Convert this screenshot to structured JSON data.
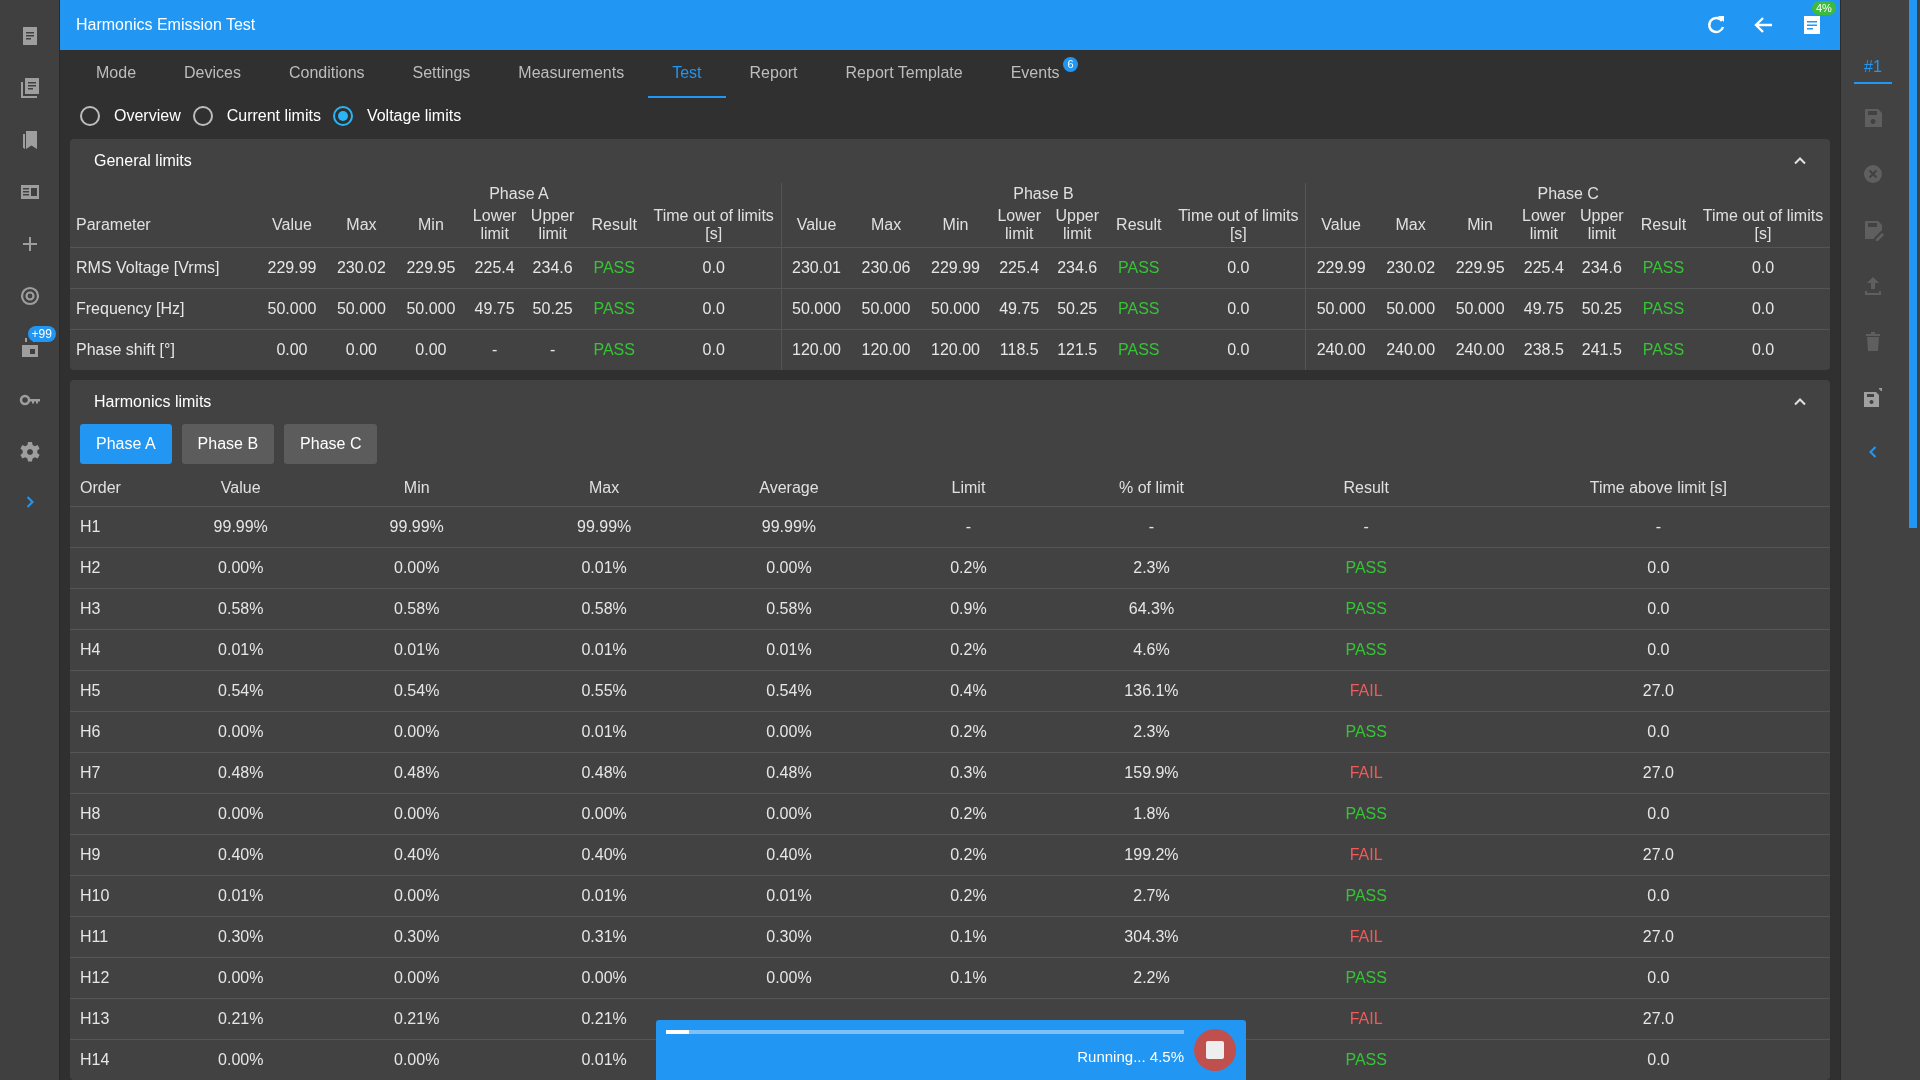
{
  "window": {
    "title": "Harmonics Emission Test",
    "report_badge": "4%"
  },
  "left_sidebar": {
    "calendar_badge": "+99"
  },
  "tabs": [
    {
      "label": "Mode",
      "selected": false
    },
    {
      "label": "Devices",
      "selected": false
    },
    {
      "label": "Conditions",
      "selected": false
    },
    {
      "label": "Settings",
      "selected": false
    },
    {
      "label": "Measurements",
      "selected": false
    },
    {
      "label": "Test",
      "selected": true
    },
    {
      "label": "Report",
      "selected": false
    },
    {
      "label": "Report Template",
      "selected": false
    },
    {
      "label": "Events",
      "selected": false,
      "badge": "6"
    }
  ],
  "view_options": [
    {
      "label": "Overview",
      "selected": false
    },
    {
      "label": "Current limits",
      "selected": false
    },
    {
      "label": "Voltage limits",
      "selected": true
    }
  ],
  "right_sidebar": {
    "tab": {
      "label": "#1",
      "selected": true
    }
  },
  "general_limits": {
    "title": "General limits",
    "expanded": true,
    "parameter_column": "Parameter",
    "phases": [
      {
        "name": "Phase A",
        "columns": [
          "Value",
          "Max",
          "Min",
          "Lower limit",
          "Upper limit",
          "Result",
          "Time out of limits [s]"
        ]
      },
      {
        "name": "Phase B",
        "columns": [
          "Value",
          "Max",
          "Min",
          "Lower limit",
          "Upper limit",
          "Result",
          "Time out of limits [s]"
        ]
      },
      {
        "name": "Phase C",
        "columns": [
          "Value",
          "Max",
          "Min",
          "Lower limit",
          "Upper limit",
          "Result",
          "Time out of limits [s]"
        ]
      }
    ],
    "rows": [
      {
        "parameter": "RMS Voltage [Vrms]",
        "phases": [
          {
            "values": [
              "229.99",
              "230.02",
              "229.95",
              "225.4",
              "234.6"
            ],
            "result": "PASS",
            "color": "#35c435",
            "time": "0.0"
          },
          {
            "values": [
              "230.01",
              "230.06",
              "229.99",
              "225.4",
              "234.6"
            ],
            "result": "PASS",
            "color": "#35c435",
            "time": "0.0"
          },
          {
            "values": [
              "229.99",
              "230.02",
              "229.95",
              "225.4",
              "234.6"
            ],
            "result": "PASS",
            "color": "#35c435",
            "time": "0.0"
          }
        ]
      },
      {
        "parameter": "Frequency [Hz]",
        "phases": [
          {
            "values": [
              "50.000",
              "50.000",
              "50.000",
              "49.75",
              "50.25"
            ],
            "result": "PASS",
            "color": "#35c435",
            "time": "0.0"
          },
          {
            "values": [
              "50.000",
              "50.000",
              "50.000",
              "49.75",
              "50.25"
            ],
            "result": "PASS",
            "color": "#35c435",
            "time": "0.0"
          },
          {
            "values": [
              "50.000",
              "50.000",
              "50.000",
              "49.75",
              "50.25"
            ],
            "result": "PASS",
            "color": "#35c435",
            "time": "0.0"
          }
        ]
      },
      {
        "parameter": "Phase shift [°]",
        "phases": [
          {
            "values": [
              "0.00",
              "0.00",
              "0.00",
              "-",
              "-"
            ],
            "result": "PASS",
            "color": "#35c435",
            "time": "0.0"
          },
          {
            "values": [
              "120.00",
              "120.00",
              "120.00",
              "118.5",
              "121.5"
            ],
            "result": "PASS",
            "color": "#35c435",
            "time": "0.0"
          },
          {
            "values": [
              "240.00",
              "240.00",
              "240.00",
              "238.5",
              "241.5"
            ],
            "result": "PASS",
            "color": "#35c435",
            "time": "0.0"
          }
        ]
      }
    ]
  },
  "harmonics_limits": {
    "title": "Harmonics limits",
    "expanded": true,
    "phase_buttons": [
      {
        "label": "Phase A",
        "selected": true
      },
      {
        "label": "Phase B",
        "selected": false
      },
      {
        "label": "Phase C",
        "selected": false
      }
    ],
    "columns": [
      "Order",
      "Value",
      "Min",
      "Max",
      "Average",
      "Limit",
      "% of limit",
      "Result",
      "Time above limit [s]"
    ],
    "rows": [
      {
        "cells": [
          "H1",
          "99.99%",
          "99.99%",
          "99.99%",
          "99.99%",
          "-",
          "-",
          "-",
          "-"
        ],
        "color": "#e0e0e0"
      },
      {
        "cells": [
          "H2",
          "0.00%",
          "0.00%",
          "0.01%",
          "0.00%",
          "0.2%",
          "2.3%",
          "PASS",
          "0.0"
        ],
        "color": "#35c435"
      },
      {
        "cells": [
          "H3",
          "0.58%",
          "0.58%",
          "0.58%",
          "0.58%",
          "0.9%",
          "64.3%",
          "PASS",
          "0.0"
        ],
        "color": "#35c435"
      },
      {
        "cells": [
          "H4",
          "0.01%",
          "0.01%",
          "0.01%",
          "0.01%",
          "0.2%",
          "4.6%",
          "PASS",
          "0.0"
        ],
        "color": "#35c435"
      },
      {
        "cells": [
          "H5",
          "0.54%",
          "0.54%",
          "0.55%",
          "0.54%",
          "0.4%",
          "136.1%",
          "FAIL",
          "27.0"
        ],
        "color": "#f05a5a"
      },
      {
        "cells": [
          "H6",
          "0.00%",
          "0.00%",
          "0.01%",
          "0.00%",
          "0.2%",
          "2.3%",
          "PASS",
          "0.0"
        ],
        "color": "#35c435"
      },
      {
        "cells": [
          "H7",
          "0.48%",
          "0.48%",
          "0.48%",
          "0.48%",
          "0.3%",
          "159.9%",
          "FAIL",
          "27.0"
        ],
        "color": "#f05a5a"
      },
      {
        "cells": [
          "H8",
          "0.00%",
          "0.00%",
          "0.00%",
          "0.00%",
          "0.2%",
          "1.8%",
          "PASS",
          "0.0"
        ],
        "color": "#35c435"
      },
      {
        "cells": [
          "H9",
          "0.40%",
          "0.40%",
          "0.40%",
          "0.40%",
          "0.2%",
          "199.2%",
          "FAIL",
          "27.0"
        ],
        "color": "#f05a5a"
      },
      {
        "cells": [
          "H10",
          "0.01%",
          "0.00%",
          "0.01%",
          "0.01%",
          "0.2%",
          "2.7%",
          "PASS",
          "0.0"
        ],
        "color": "#35c435"
      },
      {
        "cells": [
          "H11",
          "0.30%",
          "0.30%",
          "0.31%",
          "0.30%",
          "0.1%",
          "304.3%",
          "FAIL",
          "27.0"
        ],
        "color": "#f05a5a"
      },
      {
        "cells": [
          "H12",
          "0.00%",
          "0.00%",
          "0.00%",
          "0.00%",
          "0.1%",
          "2.2%",
          "PASS",
          "0.0"
        ],
        "color": "#35c435"
      },
      {
        "cells": [
          "H13",
          "0.21%",
          "0.21%",
          "0.21%",
          null,
          null,
          null,
          "FAIL",
          "27.0"
        ],
        "color": "#f05a5a"
      },
      {
        "cells": [
          "H14",
          "0.00%",
          "0.00%",
          "0.01%",
          null,
          null,
          null,
          "PASS",
          "0.0"
        ],
        "color": "#35c435"
      }
    ]
  },
  "progress": {
    "label": "Running... 4.5%",
    "level": 0.045
  }
}
